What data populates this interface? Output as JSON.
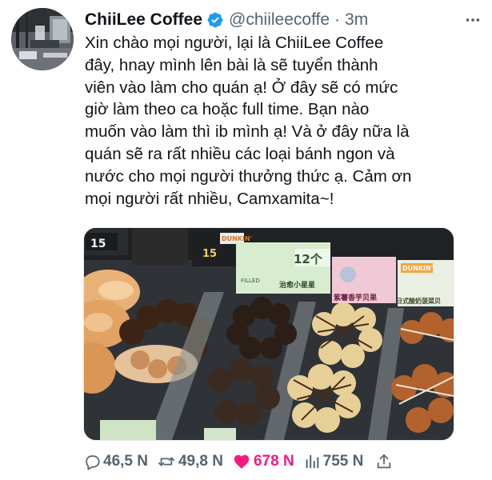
{
  "tweet": {
    "display_name": "ChiiLee Coffee",
    "handle": "@chiileecoffe",
    "separator": "·",
    "time": "3m",
    "text_lines": [
      "Xin chào mọi người, lại là ChiiLee Coffee",
      "đây, hnay mình lên bài là sẽ tuyển thành",
      "viên vào làm cho quán ạ! Ở đây sẽ có mức",
      "giờ làm theo ca hoặc full time. Bạn nào",
      "muốn vào làm thì ib mình ạ! Và ở đây nữa là",
      "quán sẽ ra rất nhiều các loại bánh ngon và",
      "nước cho mọi người thưởng thức ạ. Cảm ơn",
      "mọi người rất nhiều, Camxamita~!"
    ],
    "media": {
      "price_tags": [
        "15",
        "12个",
        "15"
      ],
      "sign_labels": [
        "FILLED",
        "治愈小星星",
        "紫薯香芋贝果",
        "日式酸奶菠菜贝"
      ],
      "brand": "DUNKIN'"
    },
    "stats": {
      "replies": "46,5 N",
      "retweets": "49,8 N",
      "likes": "678 N",
      "views": "755 N"
    }
  },
  "colors": {
    "text": "#0f1419",
    "secondary": "#536471",
    "verified": "#1d9bf0",
    "like": "#f91880"
  },
  "icons": {
    "verified": "verified-badge-icon",
    "more": "more-dots-icon",
    "reply": "reply-icon",
    "retweet": "retweet-icon",
    "like": "heart-icon",
    "views": "views-icon",
    "share": "share-icon"
  }
}
